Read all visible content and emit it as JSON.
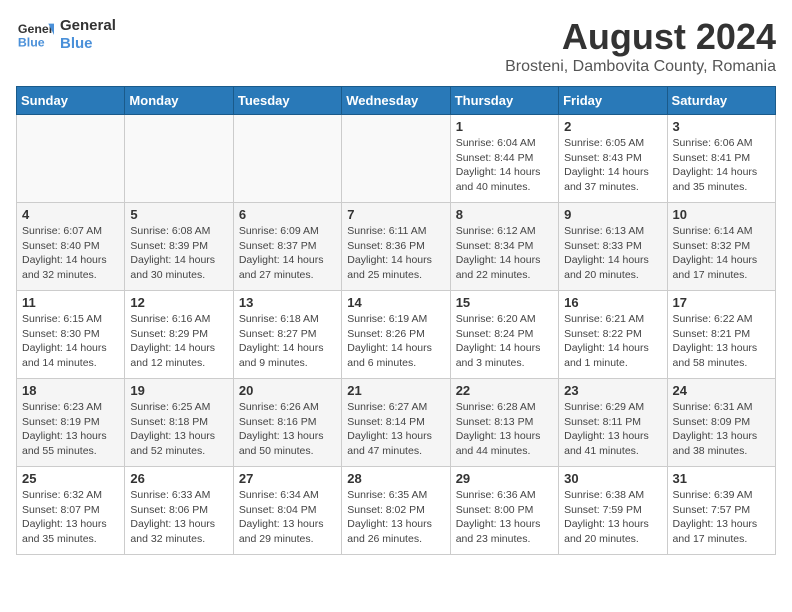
{
  "header": {
    "logo_line1": "General",
    "logo_line2": "Blue",
    "title": "August 2024",
    "subtitle": "Brosteni, Dambovita County, Romania"
  },
  "weekdays": [
    "Sunday",
    "Monday",
    "Tuesday",
    "Wednesday",
    "Thursday",
    "Friday",
    "Saturday"
  ],
  "weeks": [
    [
      {
        "day": "",
        "info": ""
      },
      {
        "day": "",
        "info": ""
      },
      {
        "day": "",
        "info": ""
      },
      {
        "day": "",
        "info": ""
      },
      {
        "day": "1",
        "info": "Sunrise: 6:04 AM\nSunset: 8:44 PM\nDaylight: 14 hours\nand 40 minutes."
      },
      {
        "day": "2",
        "info": "Sunrise: 6:05 AM\nSunset: 8:43 PM\nDaylight: 14 hours\nand 37 minutes."
      },
      {
        "day": "3",
        "info": "Sunrise: 6:06 AM\nSunset: 8:41 PM\nDaylight: 14 hours\nand 35 minutes."
      }
    ],
    [
      {
        "day": "4",
        "info": "Sunrise: 6:07 AM\nSunset: 8:40 PM\nDaylight: 14 hours\nand 32 minutes."
      },
      {
        "day": "5",
        "info": "Sunrise: 6:08 AM\nSunset: 8:39 PM\nDaylight: 14 hours\nand 30 minutes."
      },
      {
        "day": "6",
        "info": "Sunrise: 6:09 AM\nSunset: 8:37 PM\nDaylight: 14 hours\nand 27 minutes."
      },
      {
        "day": "7",
        "info": "Sunrise: 6:11 AM\nSunset: 8:36 PM\nDaylight: 14 hours\nand 25 minutes."
      },
      {
        "day": "8",
        "info": "Sunrise: 6:12 AM\nSunset: 8:34 PM\nDaylight: 14 hours\nand 22 minutes."
      },
      {
        "day": "9",
        "info": "Sunrise: 6:13 AM\nSunset: 8:33 PM\nDaylight: 14 hours\nand 20 minutes."
      },
      {
        "day": "10",
        "info": "Sunrise: 6:14 AM\nSunset: 8:32 PM\nDaylight: 14 hours\nand 17 minutes."
      }
    ],
    [
      {
        "day": "11",
        "info": "Sunrise: 6:15 AM\nSunset: 8:30 PM\nDaylight: 14 hours\nand 14 minutes."
      },
      {
        "day": "12",
        "info": "Sunrise: 6:16 AM\nSunset: 8:29 PM\nDaylight: 14 hours\nand 12 minutes."
      },
      {
        "day": "13",
        "info": "Sunrise: 6:18 AM\nSunset: 8:27 PM\nDaylight: 14 hours\nand 9 minutes."
      },
      {
        "day": "14",
        "info": "Sunrise: 6:19 AM\nSunset: 8:26 PM\nDaylight: 14 hours\nand 6 minutes."
      },
      {
        "day": "15",
        "info": "Sunrise: 6:20 AM\nSunset: 8:24 PM\nDaylight: 14 hours\nand 3 minutes."
      },
      {
        "day": "16",
        "info": "Sunrise: 6:21 AM\nSunset: 8:22 PM\nDaylight: 14 hours\nand 1 minute."
      },
      {
        "day": "17",
        "info": "Sunrise: 6:22 AM\nSunset: 8:21 PM\nDaylight: 13 hours\nand 58 minutes."
      }
    ],
    [
      {
        "day": "18",
        "info": "Sunrise: 6:23 AM\nSunset: 8:19 PM\nDaylight: 13 hours\nand 55 minutes."
      },
      {
        "day": "19",
        "info": "Sunrise: 6:25 AM\nSunset: 8:18 PM\nDaylight: 13 hours\nand 52 minutes."
      },
      {
        "day": "20",
        "info": "Sunrise: 6:26 AM\nSunset: 8:16 PM\nDaylight: 13 hours\nand 50 minutes."
      },
      {
        "day": "21",
        "info": "Sunrise: 6:27 AM\nSunset: 8:14 PM\nDaylight: 13 hours\nand 47 minutes."
      },
      {
        "day": "22",
        "info": "Sunrise: 6:28 AM\nSunset: 8:13 PM\nDaylight: 13 hours\nand 44 minutes."
      },
      {
        "day": "23",
        "info": "Sunrise: 6:29 AM\nSunset: 8:11 PM\nDaylight: 13 hours\nand 41 minutes."
      },
      {
        "day": "24",
        "info": "Sunrise: 6:31 AM\nSunset: 8:09 PM\nDaylight: 13 hours\nand 38 minutes."
      }
    ],
    [
      {
        "day": "25",
        "info": "Sunrise: 6:32 AM\nSunset: 8:07 PM\nDaylight: 13 hours\nand 35 minutes."
      },
      {
        "day": "26",
        "info": "Sunrise: 6:33 AM\nSunset: 8:06 PM\nDaylight: 13 hours\nand 32 minutes."
      },
      {
        "day": "27",
        "info": "Sunrise: 6:34 AM\nSunset: 8:04 PM\nDaylight: 13 hours\nand 29 minutes."
      },
      {
        "day": "28",
        "info": "Sunrise: 6:35 AM\nSunset: 8:02 PM\nDaylight: 13 hours\nand 26 minutes."
      },
      {
        "day": "29",
        "info": "Sunrise: 6:36 AM\nSunset: 8:00 PM\nDaylight: 13 hours\nand 23 minutes."
      },
      {
        "day": "30",
        "info": "Sunrise: 6:38 AM\nSunset: 7:59 PM\nDaylight: 13 hours\nand 20 minutes."
      },
      {
        "day": "31",
        "info": "Sunrise: 6:39 AM\nSunset: 7:57 PM\nDaylight: 13 hours\nand 17 minutes."
      }
    ]
  ]
}
